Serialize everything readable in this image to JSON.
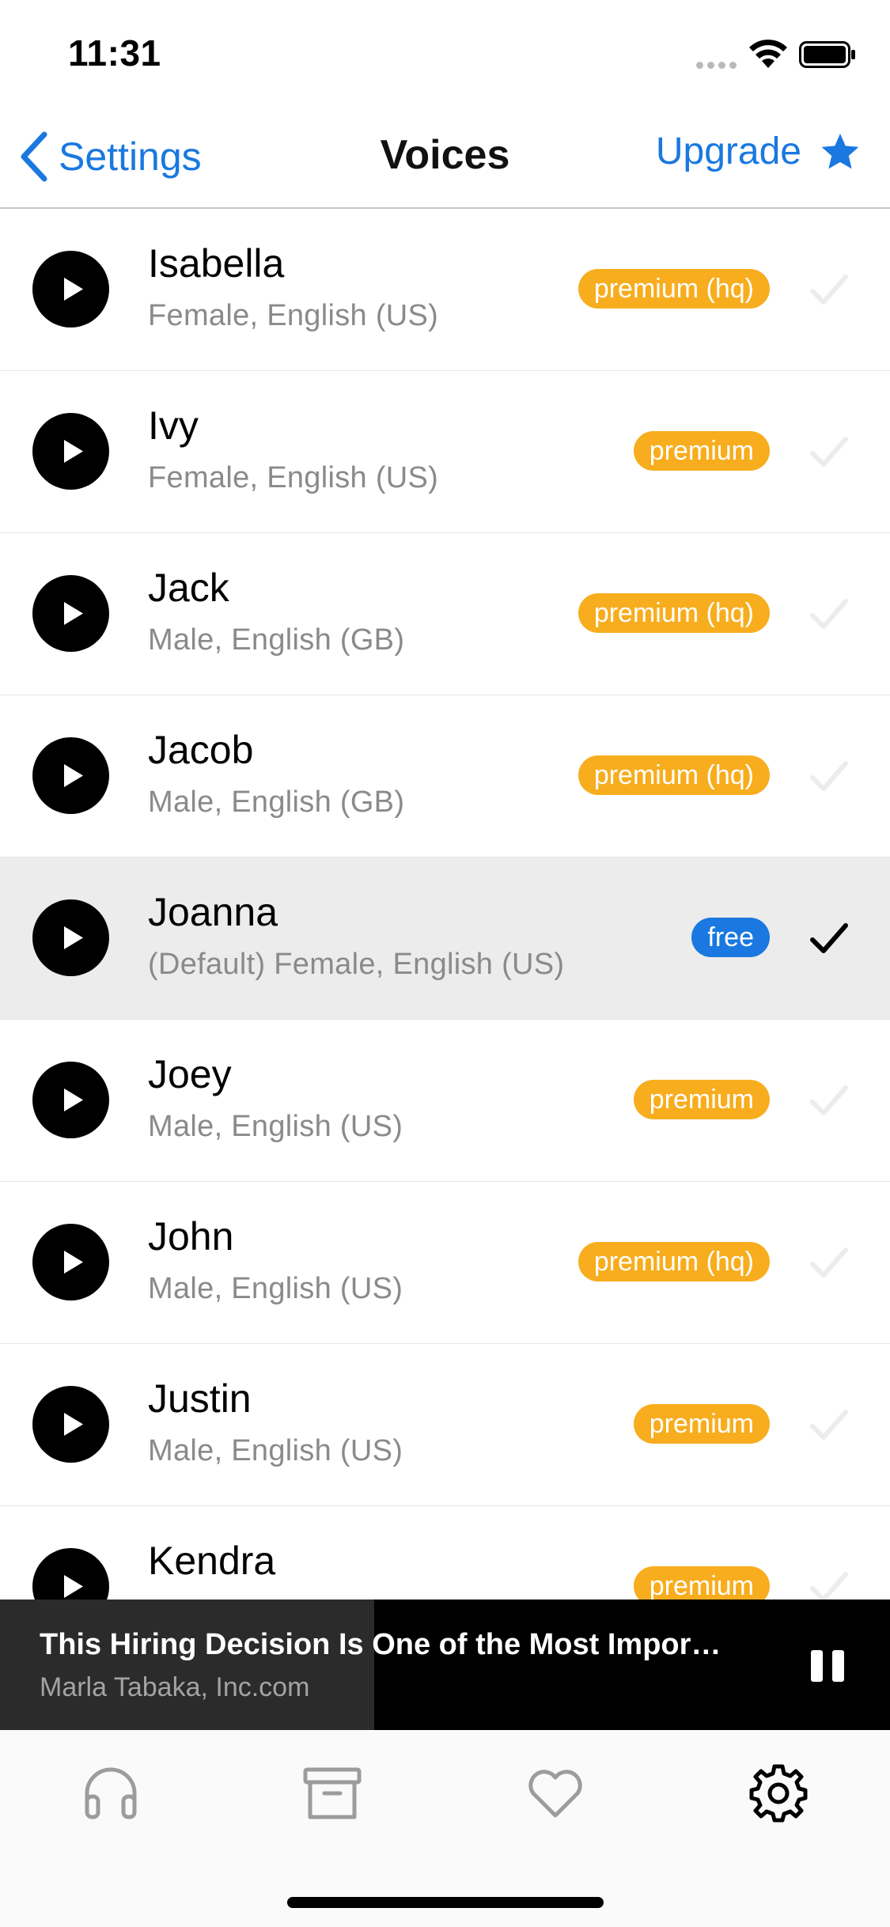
{
  "status_bar": {
    "time": "11:31"
  },
  "nav": {
    "back_label": "Settings",
    "title": "Voices",
    "upgrade_label": "Upgrade"
  },
  "colors": {
    "accent": "#1a78e0",
    "premium_badge": "#f7ad1e",
    "free_badge": "#1a78e0"
  },
  "voices": [
    {
      "name": "Isabella",
      "description": "Female, English (US)",
      "badge": "premium (hq)"
    },
    {
      "name": "Ivy",
      "description": "Female, English (US)",
      "badge": "premium"
    },
    {
      "name": "Jack",
      "description": "Male, English (GB)",
      "badge": "premium (hq)"
    },
    {
      "name": "Jacob",
      "description": "Male, English (GB)",
      "badge": "premium (hq)"
    },
    {
      "name": "Joanna",
      "description": "(Default) Female, English (US)",
      "badge": "free",
      "selected": true
    },
    {
      "name": "Joey",
      "description": "Male, English (US)",
      "badge": "premium"
    },
    {
      "name": "John",
      "description": "Male, English (US)",
      "badge": "premium (hq)"
    },
    {
      "name": "Justin",
      "description": "Male, English (US)",
      "badge": "premium"
    },
    {
      "name": "Kendra",
      "description": "",
      "badge": "premium"
    }
  ],
  "now_playing": {
    "title": "This Hiring Decision Is One of the Most Impor…",
    "subtitle": "Marla Tabaka, Inc.com",
    "progress": 0.42,
    "state": "playing"
  },
  "tab_bar": {
    "tabs": [
      {
        "icon": "headphones-icon"
      },
      {
        "icon": "archive-icon"
      },
      {
        "icon": "heart-icon"
      },
      {
        "icon": "gear-icon",
        "active": true
      }
    ]
  }
}
